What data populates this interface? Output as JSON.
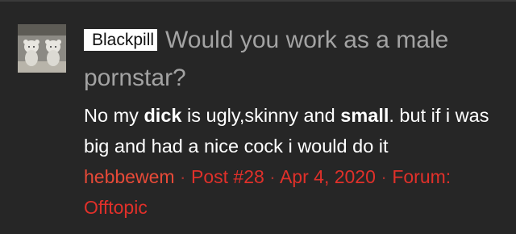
{
  "post": {
    "prefix": "Blackpill",
    "title": "Would you work as a male pornstar?",
    "body": {
      "t1": "No my ",
      "b1": "dick",
      "t2": " is ugly,skinny and ",
      "b2": "small",
      "t3": ". but if i was big and had a nice cock i would do it"
    },
    "meta": {
      "author": "hebbewem",
      "post_number": "Post #28",
      "date": "Apr 4, 2020",
      "forum_label": "Forum:",
      "forum_name": "Offtopic",
      "separator": "·"
    }
  },
  "colors": {
    "background": "#262626",
    "title": "#a3a3a3",
    "body": "#ffffff",
    "meta": "#e0302a"
  }
}
